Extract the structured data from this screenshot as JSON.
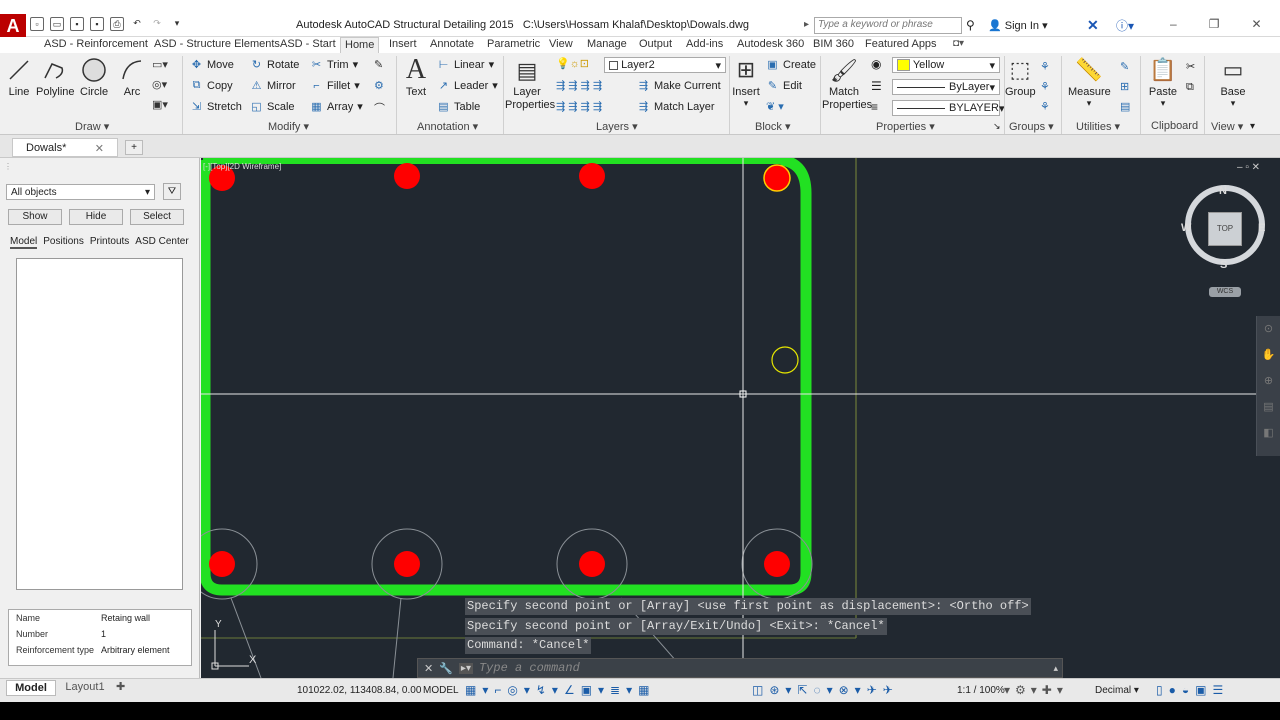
{
  "titlebar": {
    "logo": "A",
    "title": "Autodesk AutoCAD Structural Detailing 2015",
    "path": "C:\\Users\\Hossam Khalaf\\Desktop\\Dowals.dwg",
    "search_placeholder": "Type a keyword or phrase",
    "signin": "Sign In"
  },
  "tabs": [
    "ASD - Reinforcement",
    "ASD - Structure Elements",
    "ASD - Start",
    "Home",
    "Insert",
    "Annotate",
    "Parametric",
    "View",
    "Manage",
    "Output",
    "Add-ins",
    "Autodesk 360",
    "BIM 360",
    "Featured Apps"
  ],
  "active_tab": "Home",
  "ribbon": {
    "draw": {
      "line": "Line",
      "polyline": "Polyline",
      "circle": "Circle",
      "arc": "Arc",
      "title": "Draw"
    },
    "modify": {
      "move": "Move",
      "rotate": "Rotate",
      "trim": "Trim",
      "copy": "Copy",
      "mirror": "Mirror",
      "fillet": "Fillet",
      "stretch": "Stretch",
      "scale": "Scale",
      "array": "Array",
      "title": "Modify"
    },
    "annotation": {
      "text": "Text",
      "linear": "Linear",
      "leader": "Leader",
      "table": "Table",
      "title": "Annotation"
    },
    "layers": {
      "layer_properties": "Layer Properties",
      "layer_name": "Layer2",
      "make_current": "Make Current",
      "match_layer": "Match Layer",
      "title": "Layers"
    },
    "block": {
      "insert": "Insert",
      "create": "Create",
      "edit": "Edit",
      "title": "Block"
    },
    "properties": {
      "match": "Match Properties",
      "color": "Yellow",
      "linetype": "ByLayer",
      "lineweight": "BYLAYER",
      "title": "Properties"
    },
    "groups": {
      "group": "Group",
      "title": "Groups"
    },
    "utilities": {
      "measure": "Measure",
      "title": "Utilities"
    },
    "clipboard": {
      "paste": "Paste",
      "title": "Clipboard"
    },
    "view": {
      "base": "Base",
      "title": "View"
    }
  },
  "document": {
    "tab": "Dowals*"
  },
  "leftpanel": {
    "filter": "All objects",
    "show": "Show",
    "hide": "Hide",
    "select": "Select",
    "tabs": [
      "Model",
      "Positions",
      "Printouts",
      "ASD Center"
    ],
    "props": [
      {
        "k": "Name",
        "v": "Retaing wall"
      },
      {
        "k": "Number",
        "v": "1"
      },
      {
        "k": "Reinforcement type",
        "v": "Arbitrary element"
      }
    ]
  },
  "viewport": {
    "label": "[-][Top][2D Wireframe]"
  },
  "viewcube": {
    "n": "N",
    "s": "S",
    "e": "E",
    "w": "W",
    "top": "TOP",
    "wcs": "WCS"
  },
  "command": {
    "lines": [
      "Specify second point or [Array] <use first point as displacement>:  <Ortho off>",
      "Specify second point or [Array/Exit/Undo] <Exit>: *Cancel*",
      "Command: *Cancel*"
    ],
    "placeholder": "Type a command"
  },
  "ucs": {
    "x": "X",
    "y": "Y"
  },
  "layouts": [
    "Model",
    "Layout1"
  ],
  "status": {
    "coords": "101022.02, 113408.84, 0.00",
    "model": "MODEL",
    "scale": "1:1 / 100%",
    "units": "Decimal"
  },
  "colors": {
    "rebar": "#ff0000",
    "stirrup": "#22e022",
    "canvas": "#212830",
    "layer_color": "#ffff00"
  }
}
